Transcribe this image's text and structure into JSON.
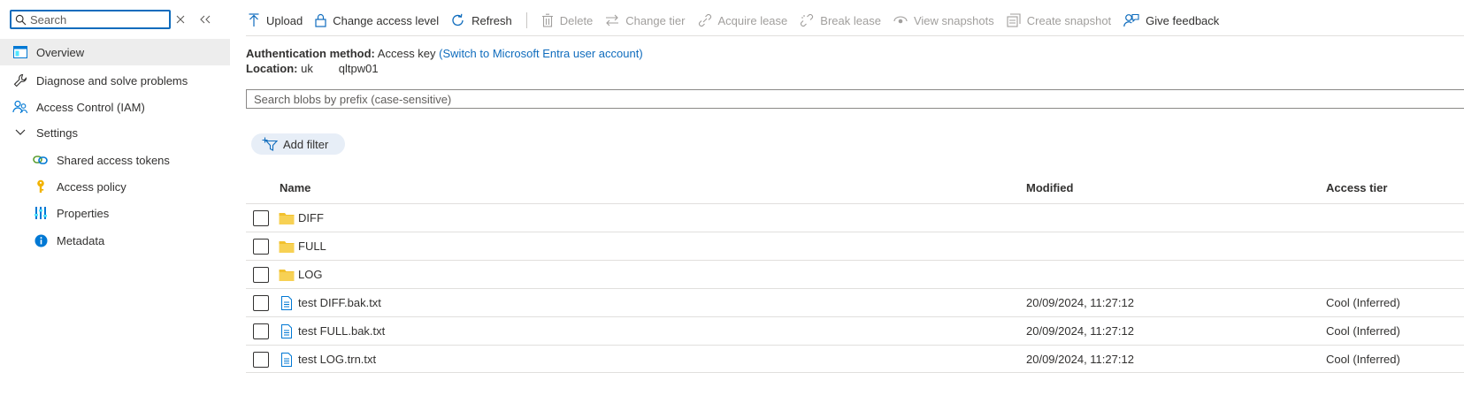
{
  "sidebar": {
    "search_placeholder": "Search",
    "items": [
      {
        "label": "Overview"
      },
      {
        "label": "Diagnose and solve problems"
      },
      {
        "label": "Access Control (IAM)"
      },
      {
        "label": "Settings"
      },
      {
        "label": "Shared access tokens"
      },
      {
        "label": "Access policy"
      },
      {
        "label": "Properties"
      },
      {
        "label": "Metadata"
      }
    ]
  },
  "toolbar": {
    "upload": "Upload",
    "change_access_level": "Change access level",
    "refresh": "Refresh",
    "delete": "Delete",
    "change_tier": "Change tier",
    "acquire_lease": "Acquire lease",
    "break_lease": "Break lease",
    "view_snapshots": "View snapshots",
    "create_snapshot": "Create snapshot",
    "give_feedback": "Give feedback"
  },
  "info": {
    "auth_label": "Authentication method:",
    "auth_value": "Access key",
    "auth_switch_link": "(Switch to Microsoft Entra user account)",
    "location_label": "Location:",
    "location_value": "uk        qltpw01"
  },
  "blob_search_placeholder": "Search blobs by prefix (case-sensitive)",
  "add_filter": "Add filter",
  "table": {
    "headers": {
      "name": "Name",
      "modified": "Modified",
      "tier": "Access tier"
    },
    "rows": [
      {
        "type": "folder",
        "name": "DIFF",
        "modified": "",
        "tier": ""
      },
      {
        "type": "folder",
        "name": "FULL",
        "modified": "",
        "tier": ""
      },
      {
        "type": "folder",
        "name": "LOG",
        "modified": "",
        "tier": ""
      },
      {
        "type": "file",
        "name": "test DIFF.bak.txt",
        "modified": "20/09/2024, 11:27:12",
        "tier": "Cool (Inferred)"
      },
      {
        "type": "file",
        "name": "test FULL.bak.txt",
        "modified": "20/09/2024, 11:27:12",
        "tier": "Cool (Inferred)"
      },
      {
        "type": "file",
        "name": "test LOG.trn.txt",
        "modified": "20/09/2024, 11:27:12",
        "tier": "Cool (Inferred)"
      }
    ]
  },
  "colors": {
    "accent": "#0f6cbd",
    "folder": "#f2c12e",
    "disabled_text": "#a19f9d"
  }
}
